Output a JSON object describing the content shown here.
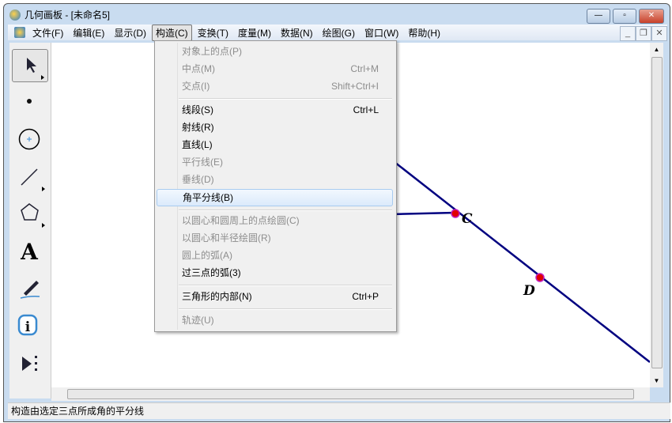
{
  "window": {
    "title": "几何画板 - [未命名5]"
  },
  "menubar": [
    "文件(F)",
    "编辑(E)",
    "显示(D)",
    "构造(C)",
    "变换(T)",
    "度量(M)",
    "数据(N)",
    "绘图(G)",
    "窗口(W)",
    "帮助(H)"
  ],
  "menu": {
    "items": [
      {
        "label": "对象上的点(P)",
        "shortcut": "",
        "enabled": false
      },
      {
        "label": "中点(M)",
        "shortcut": "Ctrl+M",
        "enabled": false
      },
      {
        "label": "交点(I)",
        "shortcut": "Shift+Ctrl+I",
        "enabled": false
      },
      {
        "label": "线段(S)",
        "shortcut": "Ctrl+L",
        "enabled": true
      },
      {
        "label": "射线(R)",
        "shortcut": "",
        "enabled": true
      },
      {
        "label": "直线(L)",
        "shortcut": "",
        "enabled": true
      },
      {
        "label": "平行线(E)",
        "shortcut": "",
        "enabled": false
      },
      {
        "label": "垂线(D)",
        "shortcut": "",
        "enabled": false
      },
      {
        "label": "角平分线(B)",
        "shortcut": "",
        "enabled": true,
        "highlighted": true
      },
      {
        "label": "以圆心和圆周上的点绘圆(C)",
        "shortcut": "",
        "enabled": false
      },
      {
        "label": "以圆心和半径绘圆(R)",
        "shortcut": "",
        "enabled": false
      },
      {
        "label": "圆上的弧(A)",
        "shortcut": "",
        "enabled": false
      },
      {
        "label": "过三点的弧(3)",
        "shortcut": "",
        "enabled": true
      },
      {
        "label": "三角形的内部(N)",
        "shortcut": "Ctrl+P",
        "enabled": true
      },
      {
        "label": "轨迹(U)",
        "shortcut": "",
        "enabled": false
      }
    ]
  },
  "canvas": {
    "points": [
      {
        "label": "C"
      },
      {
        "label": "D"
      }
    ]
  },
  "status": "构造由选定三点所成角的平分线",
  "colors": {
    "line": "#000080",
    "point": "#e00000"
  }
}
